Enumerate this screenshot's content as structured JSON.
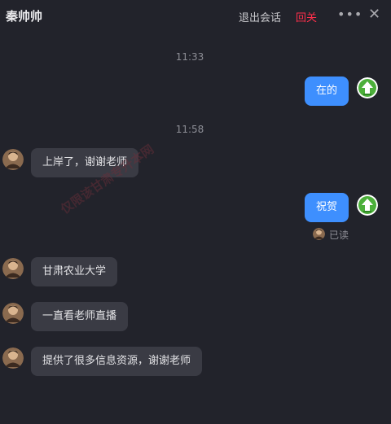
{
  "header": {
    "title": "秦帅帅",
    "exit_label": "退出会话",
    "reply_label": "回关",
    "more_icon": "more-dots-icon",
    "close_icon": "close-icon"
  },
  "timestamps": [
    "11:33",
    "11:58"
  ],
  "messages": [
    {
      "side": "right",
      "text": "在的"
    },
    {
      "side": "left",
      "text": "上岸了，谢谢老师"
    },
    {
      "side": "right",
      "text": "祝贺"
    },
    {
      "side": "left",
      "text": "甘肃农业大学"
    },
    {
      "side": "left",
      "text": "一直看老师直播"
    },
    {
      "side": "left",
      "text": "提供了很多信息资源，谢谢老师"
    }
  ],
  "read_status": "已读",
  "watermark": "仅限该甘肃专升本网",
  "colors": {
    "background": "#22232b",
    "bubble_self": "#3e8ffe",
    "bubble_other": "#3a3b44",
    "reply_accent": "#ff2f4b"
  }
}
